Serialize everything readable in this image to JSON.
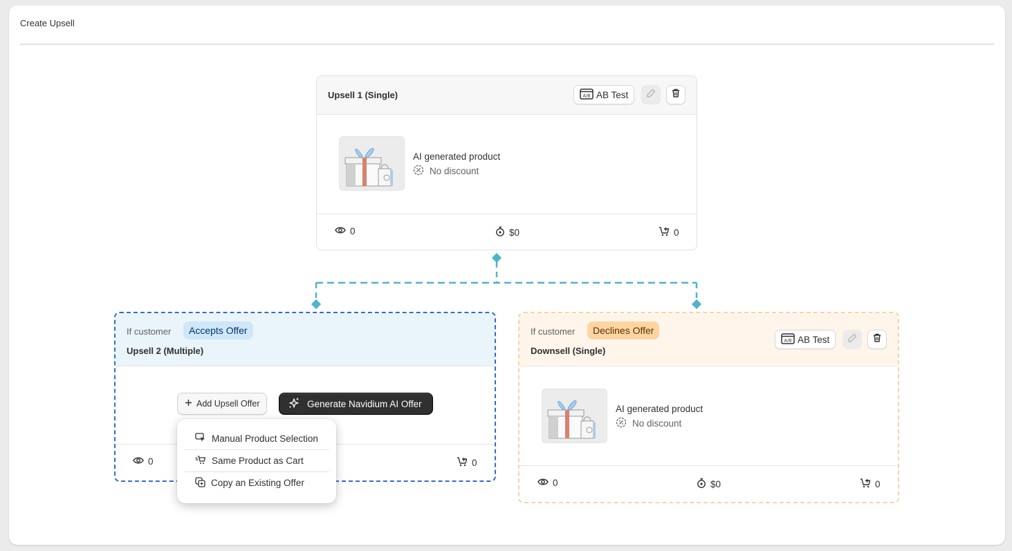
{
  "page": {
    "title": "Create Upsell"
  },
  "top_offer": {
    "name": "Upsell 1 (Single)",
    "ab_test_label": "AB Test",
    "product": {
      "name": "AI generated product",
      "discount": "No discount"
    },
    "stats": {
      "views": "0",
      "revenue": "$0",
      "orders": "0"
    }
  },
  "accept_branch": {
    "condition_text": "If customer",
    "badge": "Accepts Offer",
    "name": "Upsell 2 (Multiple)",
    "add_button": "Add Upsell Offer",
    "ai_button": "Generate Navidium AI Offer",
    "stats": {
      "views": "0",
      "orders": "0"
    },
    "menu": [
      {
        "label": "Manual Product Selection",
        "icon": "cursor-select-icon"
      },
      {
        "label": "Same Product as Cart",
        "icon": "cart-fast-icon"
      },
      {
        "label": "Copy an Existing Offer",
        "icon": "copy-icon"
      }
    ]
  },
  "decline_branch": {
    "condition_text": "If customer",
    "badge": "Declines Offer",
    "name": "Downsell (Single)",
    "ab_test_label": "AB Test",
    "product": {
      "name": "AI generated product",
      "discount": "No discount"
    },
    "stats": {
      "views": "0",
      "revenue": "$0",
      "orders": "0"
    }
  },
  "colors": {
    "connector": "#4fb3c9",
    "accept_border": "#2c6ecb",
    "decline_border": "#f7d3a6",
    "accept_badge": "#cfe7f9",
    "decline_badge": "#fdd5a3",
    "ai_button": "#303030"
  }
}
